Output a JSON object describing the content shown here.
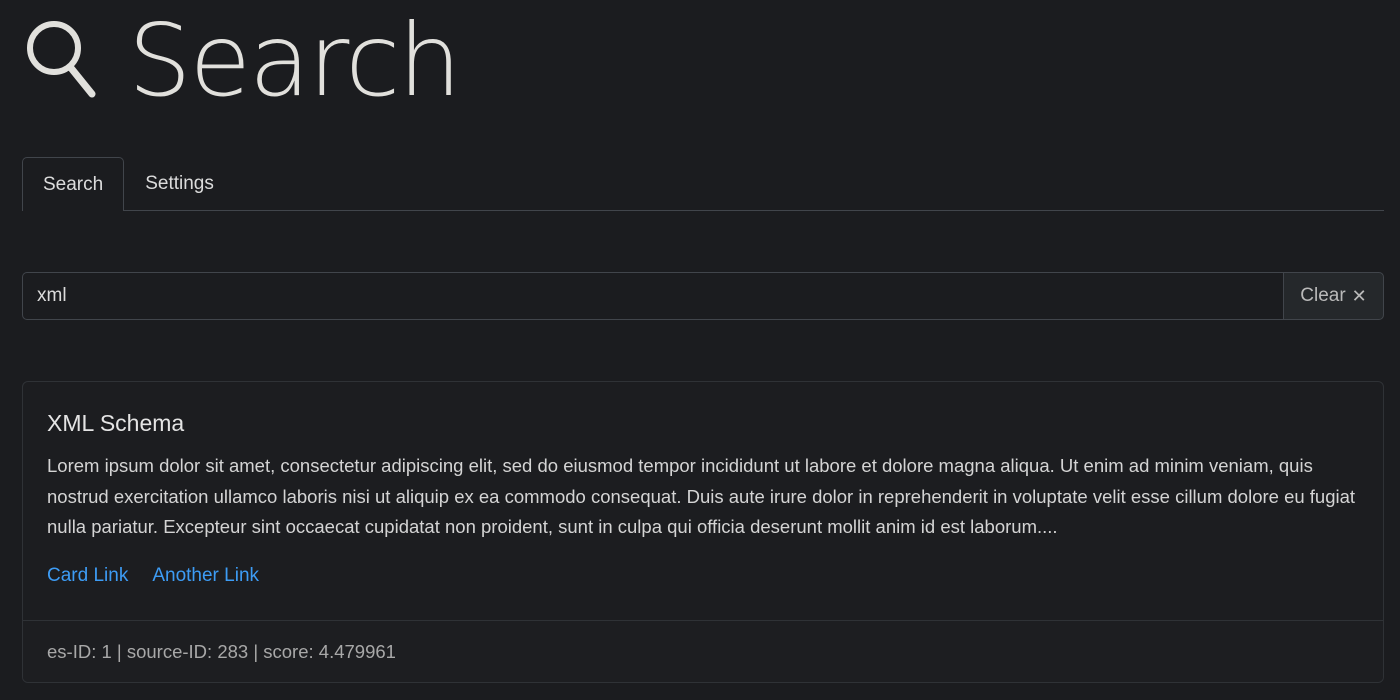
{
  "header": {
    "icon": "search-icon",
    "title": "Search"
  },
  "tabs": [
    {
      "label": "Search",
      "active": true
    },
    {
      "label": "Settings",
      "active": false
    }
  ],
  "search": {
    "value": "xml",
    "clear_label": "Clear",
    "clear_icon": "close-icon"
  },
  "result": {
    "title": "XML Schema",
    "text": "Lorem ipsum dolor sit amet, consectetur adipiscing elit, sed do eiusmod tempor incididunt ut labore et dolore magna aliqua. Ut enim ad minim veniam, quis nostrud exercitation ullamco laboris nisi ut aliquip ex ea commodo consequat. Duis aute irure dolor in reprehenderit in voluptate velit esse cillum dolore eu fugiat nulla pariatur. Excepteur sint occaecat cupidatat non proident, sunt in culpa qui officia deserunt mollit anim id est laborum....",
    "links": [
      "Card Link",
      "Another Link"
    ],
    "footer": "es-ID: 1 | source-ID: 283 | score: 4.479961"
  },
  "colors": {
    "background": "#1b1c1f",
    "border": "#41454b",
    "link": "#3d9cf5",
    "text": "#dcdcdc"
  }
}
